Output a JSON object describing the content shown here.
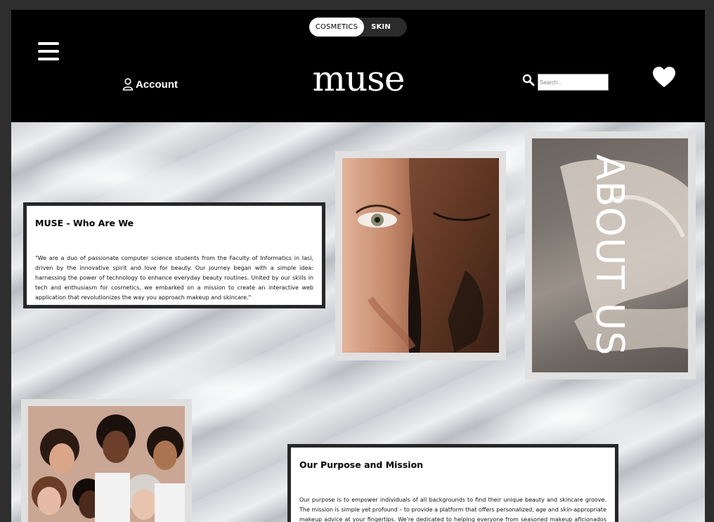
{
  "header": {
    "toggle": {
      "active": "COSMETICS",
      "inactive": "SKIN"
    },
    "account_label": "Account",
    "logo": "muse",
    "search_placeholder": "Search..."
  },
  "about_label": "ABOUT US",
  "who": {
    "title": "MUSE - Who Are We",
    "body": "\"We are a duo of passionate computer science students from the Faculty of Informatics in Iasi, driven by the innovative spirit and love for beauty. Our journey began with a simple idea: harnessing the power of technology to enhance everyday beauty routines. United by our skills in tech and enthusiasm for cosmetics, we embarked on a mission to create an interactive web application that revolutionizes the way you approach makeup and skincare.\""
  },
  "mission": {
    "title": "Our Purpose and Mission",
    "body": "Our purpose is to empower individuals of all backgrounds to find their unique beauty and skincare groove. The mission is simple yet profound – to provide a platform that offers personalized, age and skin-appropriate makeup advice at your fingertips. We're dedicated to helping everyone from seasoned makeup aficionados to absolute beginners discover makeup"
  },
  "colors": {
    "header_bg": "#000000",
    "card_border": "#272727",
    "photo_frame": "#e0e0e0"
  }
}
